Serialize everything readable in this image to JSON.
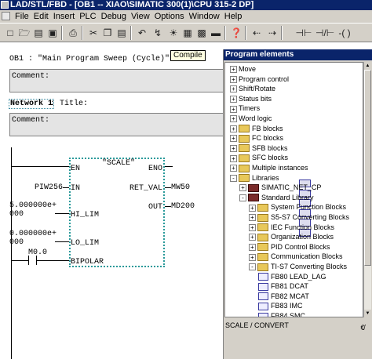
{
  "window": {
    "title": "LAD/STL/FBD  - [OB1 -- XIAO\\SIMATIC 300(1)\\CPU 315-2 DP]"
  },
  "menubar": {
    "items": [
      "File",
      "Edit",
      "Insert",
      "PLC",
      "Debug",
      "View",
      "Options",
      "Window",
      "Help"
    ]
  },
  "toolbar": {
    "icons": [
      "new-icon",
      "open-icon",
      "accessible-nodes-icon",
      "save-icon",
      "print-icon",
      "cut-icon",
      "copy-icon",
      "paste-icon",
      "undo-icon",
      "download-icon",
      "monitor-icon",
      "overview-icon",
      "program-elements-icon",
      "text-icon",
      "help-icon",
      "back-icon",
      "forward-icon",
      "normally-open-contact-icon",
      "normally-closed-contact-icon",
      "coil-icon"
    ],
    "tooltip": "Compile"
  },
  "editor": {
    "block_header": "OB1 :  \"Main Program Sweep (Cycle)\"",
    "block_comment_label": "Comment:",
    "network_label": "Network 1",
    "network_title": ": Title:",
    "network_comment_label": "Comment:",
    "block_name": "\"SCALE\"",
    "pins": {
      "en": "EN",
      "eno": "ENO",
      "in": "IN",
      "ret_val": "RET_VAL",
      "out": "OUT",
      "hi_lim": "HI_LIM",
      "lo_lim": "LO_LIM",
      "bipolar": "BIPOLAR"
    },
    "operands": {
      "in": "PIW256",
      "ret_val": "MW50",
      "out": "MD200",
      "hi_lim_line1": "5.000000e+",
      "hi_lim_line2": "000",
      "lo_lim_line1": "0.000000e+",
      "lo_lim_line2": "000",
      "bipolar": "M0.0"
    }
  },
  "panel": {
    "title": "Program elements",
    "tree": [
      {
        "label": "Move",
        "expander": "+",
        "icon": "block",
        "level": 0
      },
      {
        "label": "Program control",
        "expander": "+",
        "icon": "block",
        "level": 0
      },
      {
        "label": "Shift/Rotate",
        "expander": "+",
        "icon": "block",
        "level": 0
      },
      {
        "label": "Status bits",
        "expander": "+",
        "icon": "block",
        "level": 0
      },
      {
        "label": "Timers",
        "expander": "+",
        "icon": "block",
        "level": 0
      },
      {
        "label": "Word logic",
        "expander": "+",
        "icon": "block",
        "level": 0
      },
      {
        "label": "FB blocks",
        "expander": "+",
        "icon": "folder",
        "level": 0
      },
      {
        "label": "FC blocks",
        "expander": "+",
        "icon": "folder",
        "level": 0
      },
      {
        "label": "SFB blocks",
        "expander": "+",
        "icon": "folder",
        "level": 0
      },
      {
        "label": "SFC blocks",
        "expander": "+",
        "icon": "folder",
        "level": 0
      },
      {
        "label": "Multiple instances",
        "expander": "+",
        "icon": "folder",
        "level": 0
      },
      {
        "label": "Libraries",
        "expander": "-",
        "icon": "folder",
        "level": 0
      },
      {
        "label": "SIMATIC_NET_CP",
        "expander": "+",
        "icon": "book",
        "level": 1
      },
      {
        "label": "Standard Library",
        "expander": "-",
        "icon": "book",
        "level": 1
      },
      {
        "label": "System Function Blocks",
        "expander": "+",
        "icon": "folder",
        "level": 2
      },
      {
        "label": "S5-S7 Converting Blocks",
        "expander": "+",
        "icon": "folder",
        "level": 2
      },
      {
        "label": "IEC Function Blocks",
        "expander": "+",
        "icon": "folder",
        "level": 2
      },
      {
        "label": "Organization Blocks",
        "expander": "+",
        "icon": "folder",
        "level": 2
      },
      {
        "label": "PID Control Blocks",
        "expander": "+",
        "icon": "folder",
        "level": 2
      },
      {
        "label": "Communication Blocks",
        "expander": "+",
        "icon": "folder",
        "level": 2
      },
      {
        "label": "TI-S7 Converting Blocks",
        "expander": "-",
        "icon": "folder",
        "level": 2
      },
      {
        "label": "FB80      LEAD_LAG",
        "expander": "",
        "icon": "fb",
        "level": 3
      },
      {
        "label": "FB81      DCAT",
        "expander": "",
        "icon": "fb",
        "level": 3
      },
      {
        "label": "FB82      MCAT",
        "expander": "",
        "icon": "fb",
        "level": 3
      },
      {
        "label": "FB83      IMC",
        "expander": "",
        "icon": "fb",
        "level": 3
      },
      {
        "label": "FB84      SMC",
        "expander": "",
        "icon": "fb",
        "level": 3
      }
    ],
    "status": "SCALE / CONVERT",
    "status_button": "€̸"
  },
  "colors": {
    "titlebar": "#0a246a",
    "chrome": "#d4d0c8",
    "comment_bg": "#e4e4e4",
    "block_border": "#2a9a9a"
  }
}
